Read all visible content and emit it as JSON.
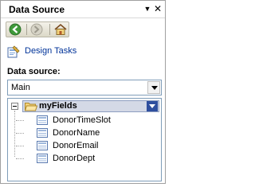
{
  "pane": {
    "title": "Data Source"
  },
  "toolbar": {
    "back_icon": "back-arrow-icon",
    "forward_icon": "forward-arrow-icon",
    "home_icon": "home-icon"
  },
  "design_tasks": {
    "label": "Design Tasks"
  },
  "data_source": {
    "label": "Data source:",
    "selected": "Main"
  },
  "tree": {
    "root": {
      "label": "myFields"
    },
    "fields": [
      {
        "label": "DonorTimeSlot"
      },
      {
        "label": "DonorName"
      },
      {
        "label": "DonorEmail"
      },
      {
        "label": "DonorDept"
      }
    ]
  },
  "colors": {
    "accent": "#2f4f9e",
    "link": "#003399",
    "selection": "#d4d9e6"
  }
}
